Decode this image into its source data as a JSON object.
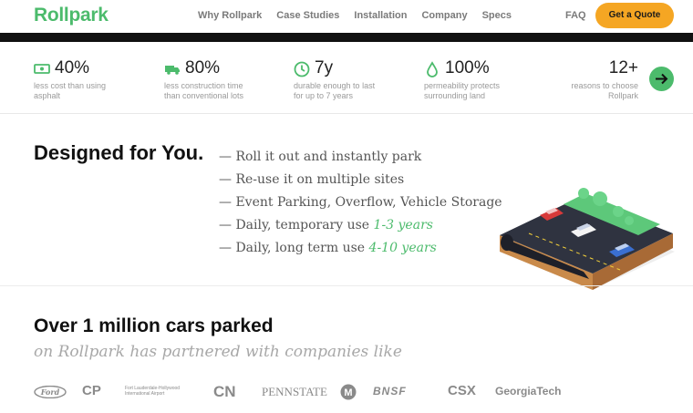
{
  "nav": {
    "logo": "Rollpark",
    "links": [
      "Why Rollpark",
      "Case Studies",
      "Installation",
      "Company",
      "Specs"
    ],
    "faq": "FAQ",
    "cta": "Get a Quote"
  },
  "stats": [
    {
      "value": "40%",
      "desc1": "less cost than using",
      "desc2": "asphalt",
      "icon": "money-icon"
    },
    {
      "value": "80%",
      "desc1": "less construction time",
      "desc2": "than conventional lots",
      "icon": "truck-icon"
    },
    {
      "value": "7y",
      "desc1": "durable enough to last",
      "desc2": "for up to 7 years",
      "icon": "clock-icon"
    },
    {
      "value": "100%",
      "desc1": "permeability protects",
      "desc2": "surrounding land",
      "icon": "water-drop-icon"
    },
    {
      "value": "12+",
      "desc1": "reasons to choose",
      "desc2": "Rollpark"
    }
  ],
  "designed": {
    "title": "Designed for You.",
    "features": [
      {
        "text": "— Roll it out and instantly park",
        "highlight": ""
      },
      {
        "text": "— Re-use it on multiple sites",
        "highlight": ""
      },
      {
        "text": "— Event Parking, Overflow, Vehicle Storage",
        "highlight": ""
      },
      {
        "text": "— Daily, temporary use ",
        "highlight": "1-3 years"
      },
      {
        "text": "— Daily, long term use ",
        "highlight": "4-10 years"
      }
    ]
  },
  "partners": {
    "title": "Over 1 million cars parked",
    "subtitle": "on Rollpark has partnered with companies like",
    "logos": [
      "Ford",
      "CP",
      "Fort Lauderdale-Hollywood International Airport",
      "CN",
      "PENNSTATE",
      "M",
      "BNSF",
      "CSX",
      "GeorgiaTech"
    ]
  },
  "colors": {
    "brand_green": "#4cbb6c",
    "cta_orange": "#f5a623"
  }
}
